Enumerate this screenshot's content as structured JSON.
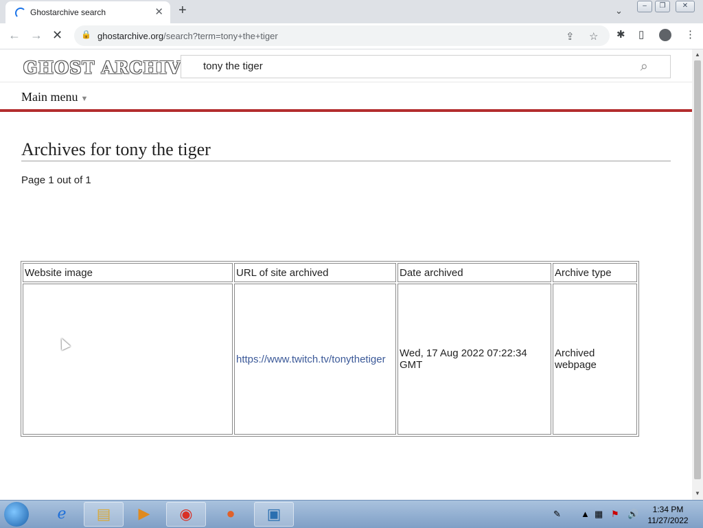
{
  "browser": {
    "tab_title": "Ghostarchive search",
    "new_tab_label": "+",
    "url_host": "ghostarchive.org",
    "url_path": "/search?term=tony+the+tiger"
  },
  "site": {
    "logo_text": "GHOST ARCHIVE",
    "search_value": "tony the tiger",
    "main_menu_label": "Main menu"
  },
  "content": {
    "heading": "Archives for tony the tiger",
    "page_info": "Page 1 out of 1",
    "table": {
      "headers": [
        "Website image",
        "URL of site archived",
        "Date archived",
        "Archive type"
      ],
      "rows": [
        {
          "image": "",
          "url": "https://www.twitch.tv/tonythetiger",
          "date": "Wed, 17 Aug 2022 07:22:34 GMT",
          "type": "Archived webpage"
        }
      ]
    }
  },
  "taskbar": {
    "clock_time": "1:34 PM",
    "clock_date": "11/27/2022"
  },
  "icons": {
    "spinner": "loading-spinner-icon",
    "close": "close-icon",
    "back": "back-arrow-icon",
    "forward": "forward-arrow-icon",
    "reload": "stop-reload-icon",
    "lock": "lock-icon",
    "share": "share-icon",
    "star": "star-icon",
    "extensions": "puzzle-icon",
    "sidepanel": "side-panel-icon",
    "profile": "profile-icon",
    "menu": "kebab-menu-icon",
    "search": "search-icon"
  },
  "colors": {
    "accent_red": "#b32d2e",
    "link": "#3b5998"
  }
}
